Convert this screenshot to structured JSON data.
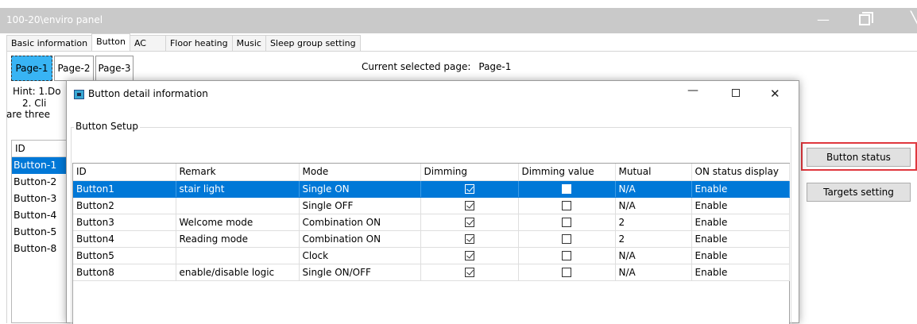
{
  "window": {
    "title": "100-20\\enviro panel"
  },
  "tabs": [
    "Basic information",
    "Button",
    "AC",
    "Floor heating",
    "Music",
    "Sleep group setting"
  ],
  "active_tab": "Button",
  "pages": [
    "Page-1",
    "Page-2",
    "Page-3"
  ],
  "current_page": {
    "label": "Current selected page:",
    "value": "Page-1"
  },
  "hints": {
    "line1": "Hint: 1.Do",
    "line2": "2. Cli",
    "line3": "are three"
  },
  "left_list": {
    "header": "ID",
    "items": [
      "Button-1",
      "Button-2",
      "Button-3",
      "Button-4",
      "Button-5",
      "Button-8"
    ],
    "selected_index": 0
  },
  "side_buttons": {
    "status": "Button status",
    "targets": "Targets setting"
  },
  "dialog": {
    "title": "Button detail information",
    "group_label": "Button Setup",
    "columns": [
      "ID",
      "Remark",
      "Mode",
      "Dimming",
      "Dimming value",
      "Mutual",
      "ON status display"
    ],
    "rows": [
      {
        "id": "Button1",
        "remark": "stair light",
        "mode": "Single ON",
        "dimming": true,
        "dimming_value": false,
        "mutual": "N/A",
        "on_status": "Enable"
      },
      {
        "id": "Button2",
        "remark": "",
        "mode": "Single OFF",
        "dimming": true,
        "dimming_value": false,
        "mutual": "N/A",
        "on_status": "Enable"
      },
      {
        "id": "Button3",
        "remark": "Welcome mode",
        "mode": "Combination ON",
        "dimming": true,
        "dimming_value": false,
        "mutual": "2",
        "on_status": "Enable"
      },
      {
        "id": "Button4",
        "remark": "Reading mode",
        "mode": "Combination ON",
        "dimming": true,
        "dimming_value": false,
        "mutual": "2",
        "on_status": "Enable"
      },
      {
        "id": "Button5",
        "remark": "",
        "mode": "Clock",
        "dimming": true,
        "dimming_value": false,
        "mutual": "N/A",
        "on_status": "Enable"
      },
      {
        "id": "Button8",
        "remark": "enable/disable logic",
        "mode": "Single ON/OFF",
        "dimming": true,
        "dimming_value": false,
        "mutual": "N/A",
        "on_status": "Enable"
      }
    ],
    "selected_row": 0
  },
  "colors": {
    "selection": "#0078d7",
    "page_active": "#38b4f4",
    "highlight_outline": "#e0383e"
  }
}
